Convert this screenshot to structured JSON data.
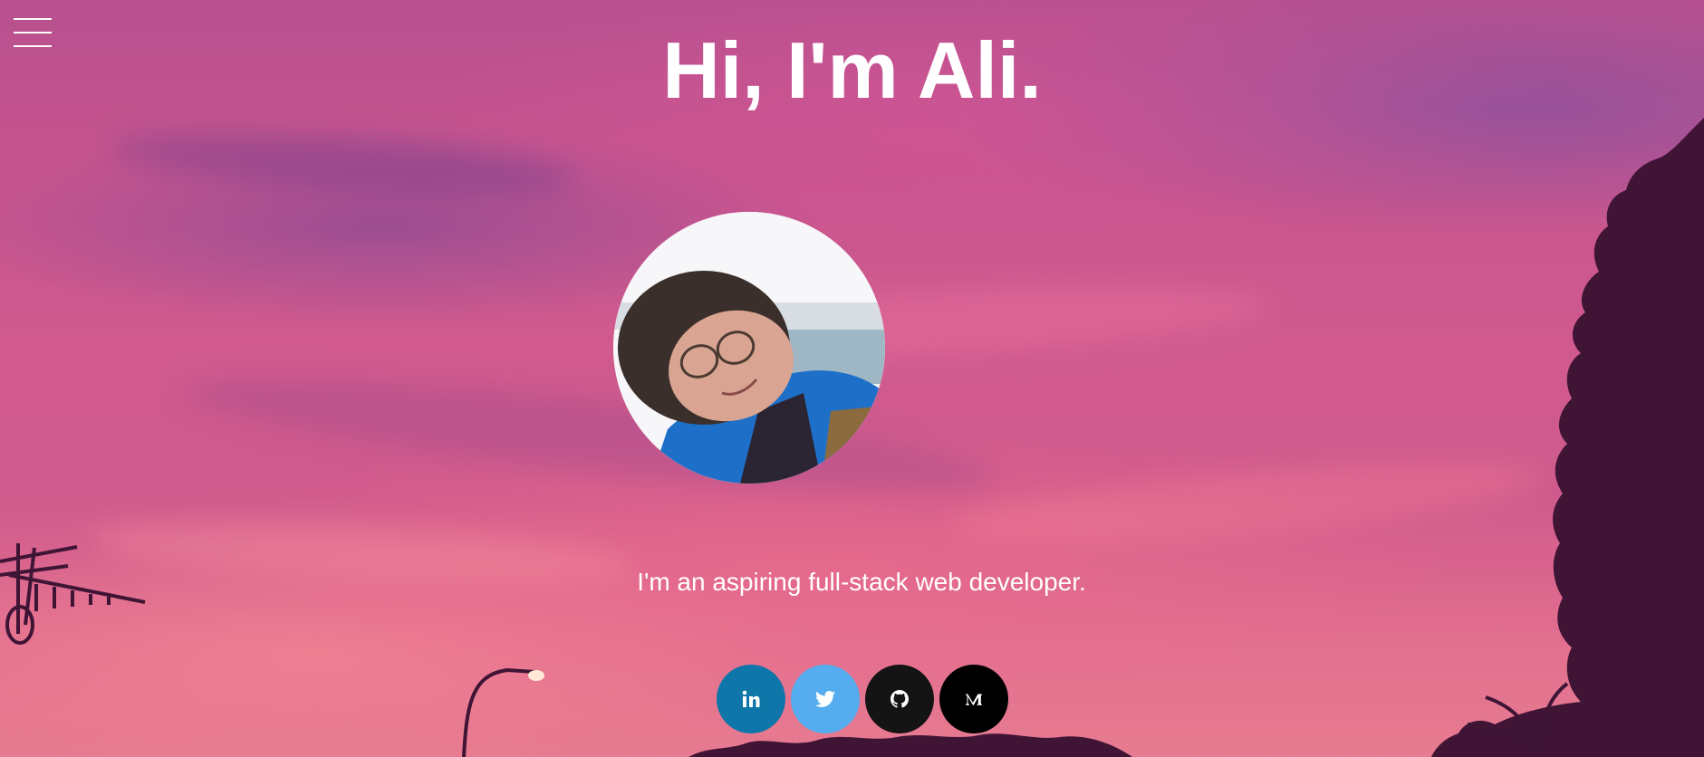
{
  "header": {
    "title": "Hi, I'm Ali."
  },
  "profile": {
    "tagline": "I'm an aspiring full-stack web developer."
  },
  "social_links": [
    {
      "name": "linkedin",
      "icon": "linkedin-icon",
      "color": "#0e76a8"
    },
    {
      "name": "twitter",
      "icon": "twitter-icon",
      "color": "#55acee"
    },
    {
      "name": "github",
      "icon": "github-icon",
      "color": "#141414"
    },
    {
      "name": "medium",
      "icon": "medium-icon",
      "color": "#000000"
    }
  ],
  "colors": {
    "sky_top": "#b8508f",
    "sky_bottom": "#e77b90",
    "text": "#ffffff",
    "silhouette": "#3f1435"
  }
}
